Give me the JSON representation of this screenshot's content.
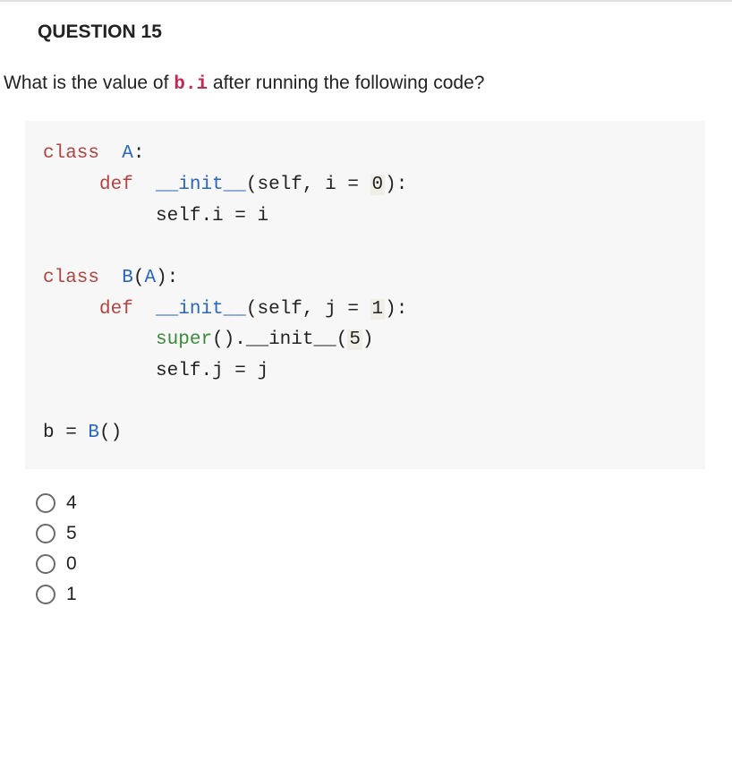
{
  "question": {
    "heading": "QUESTION 15",
    "prompt_pre": "What is the value of ",
    "prompt_code": "b.i",
    "prompt_post": " after running the following code?"
  },
  "code": {
    "l1_kw": "class",
    "l1_name": "A",
    "l1_colon": ":",
    "l2_def": "def",
    "l2_fn": "__init__",
    "l2_args_open": "(",
    "l2_self": "self",
    "l2_comma": ", ",
    "l2_arg": "i",
    "l2_eq": " = ",
    "l2_val": "0",
    "l2_close": "):",
    "l3": "self.i = i",
    "l4_kw": "class",
    "l4_name": "B",
    "l4_paren_open": "(",
    "l4_base": "A",
    "l4_close": "):",
    "l5_def": "def",
    "l5_fn": "__init__",
    "l5_args_open": "(",
    "l5_self": "self",
    "l5_comma": ", ",
    "l5_arg": "j",
    "l5_eq": " = ",
    "l5_val": "1",
    "l5_close": "):",
    "l6_super": "super",
    "l6_parens": "()",
    "l6_dot": ".",
    "l6_init": "__init__",
    "l6_open": "(",
    "l6_arg": "5",
    "l6_close": ")",
    "l7": "self.j = j",
    "l8_b": "b",
    "l8_eq": " = ",
    "l8_B": "B",
    "l8_parens": "()"
  },
  "options": [
    {
      "label": "4"
    },
    {
      "label": "5"
    },
    {
      "label": "0"
    },
    {
      "label": "1"
    }
  ]
}
